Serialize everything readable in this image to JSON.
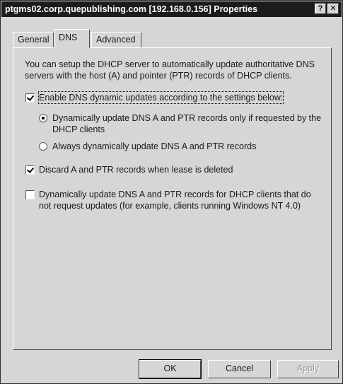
{
  "window": {
    "title": "ptgms02.corp.quepublishing.com [192.168.0.156] Properties",
    "help_button": "?",
    "close_button": "✕"
  },
  "tabs": [
    {
      "label": "General",
      "active": false
    },
    {
      "label": "DNS",
      "active": true
    },
    {
      "label": "Advanced",
      "active": false
    }
  ],
  "dns": {
    "description": "You can setup the DHCP server to automatically update authoritative DNS servers with the host (A) and pointer (PTR) records of DHCP clients.",
    "enable_updates": {
      "label": "Enable DNS dynamic updates according to the settings below:",
      "checked": true
    },
    "radio_requested": {
      "label": "Dynamically update DNS A and PTR records only if requested by the DHCP clients",
      "selected": true
    },
    "radio_always": {
      "label": "Always dynamically update DNS A and PTR records",
      "selected": false
    },
    "discard_records": {
      "label": "Discard A and PTR records when lease is deleted",
      "checked": true
    },
    "update_non_requesting": {
      "label": "Dynamically update DNS A and PTR records for DHCP clients that do not request updates (for example, clients running Windows NT 4.0)",
      "checked": false
    }
  },
  "buttons": {
    "ok": "OK",
    "cancel": "Cancel",
    "apply": "Apply"
  }
}
